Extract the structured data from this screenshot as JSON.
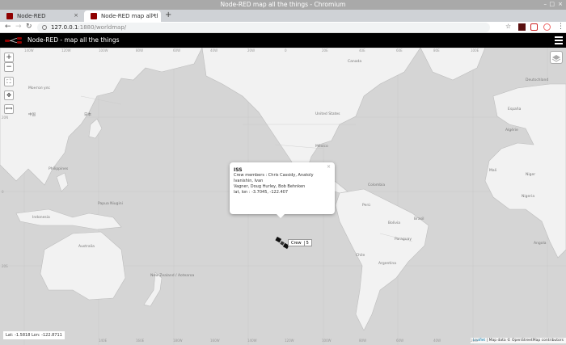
{
  "window": {
    "title": "Node-RED map all the things - Chromium"
  },
  "tabs": [
    {
      "label": "Node-RED"
    },
    {
      "label": "Node-RED map all the th"
    }
  ],
  "address": {
    "host": "127.0.0.1",
    "path": ":1880/worldmap/"
  },
  "app": {
    "title": "Node-RED - map all the things"
  },
  "map_controls": {
    "zoom_in": "+",
    "zoom_out": "−",
    "ruler": "⟺"
  },
  "popup": {
    "title": "ISS",
    "line1": "Crew members : Chris Cassidy, Anatoly Ivanishin, Ivan",
    "line2": "Vagner, Doug Hurley, Bob Behnken",
    "line3": "lat, lon : -3.7045, -122.407",
    "close": "×"
  },
  "crew_label": {
    "label": "Crew",
    "count": "5"
  },
  "coords": {
    "text": "Lat: -1.5818  Lon: -122.8711"
  },
  "attribution": {
    "leaflet": "Leaflet",
    "rest": " | Map data © OpenStreetMap contributors"
  },
  "graticule": {
    "top": [
      "140W",
      "120W",
      "100W",
      "80W",
      "60W",
      "40W",
      "20W",
      "0",
      "20E",
      "40E",
      "60E",
      "80E",
      "100E"
    ],
    "bottom": [
      "140E",
      "160E",
      "180W",
      "160W",
      "140W",
      "120W",
      "100W",
      "80W",
      "60W",
      "40W",
      "20W"
    ],
    "left": [
      "20N",
      "0",
      "20S"
    ]
  },
  "labels": {
    "united_states": "United States",
    "mexico": "México",
    "colombia": "Colombia",
    "peru": "Perú",
    "bolivia": "Bolivia",
    "brasil": "Brasil",
    "paraguay": "Paraguay",
    "argentina": "Argentina",
    "chile": "Chile",
    "australia": "Australia",
    "nz": "New Zealand / Aotearoa",
    "indonesia": "Indonesia",
    "png": "Papua Niugini",
    "philippines": "Philippines",
    "mongolia": "Монгол улс",
    "china": "中国",
    "japan": "日本",
    "canada": "Canada",
    "algeria": "Algérie",
    "espana": "España",
    "deutschland": "Deutschland",
    "nigeria": "Nigeria",
    "mali": "Mali",
    "niger": "Niger",
    "angola": "Angola"
  },
  "colors": {
    "land": "#f2f2f2",
    "water": "#d4d4d4",
    "header": "#000000",
    "favicon": "#8f0000"
  }
}
